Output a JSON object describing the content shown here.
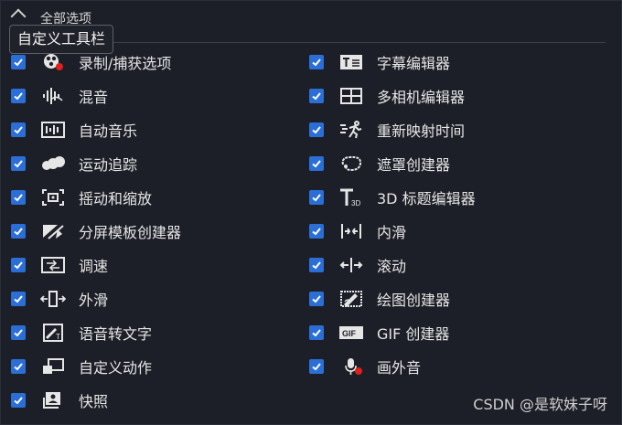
{
  "header": {
    "title": "全部选项",
    "tooltip": "自定义工具栏"
  },
  "left_items": [
    {
      "label": "录制/捕获选项",
      "icon": "record-capture-icon",
      "checked": true
    },
    {
      "label": "混音",
      "icon": "audio-mix-icon",
      "checked": true
    },
    {
      "label": "自动音乐",
      "icon": "auto-music-icon",
      "checked": true
    },
    {
      "label": "运动追踪",
      "icon": "motion-tracking-icon",
      "checked": true
    },
    {
      "label": "摇动和缩放",
      "icon": "pan-zoom-icon",
      "checked": true
    },
    {
      "label": "分屏模板创建器",
      "icon": "split-screen-icon",
      "checked": true
    },
    {
      "label": "调速",
      "icon": "speed-icon",
      "checked": true
    },
    {
      "label": "外滑",
      "icon": "slide-out-icon",
      "checked": true
    },
    {
      "label": "语音转文字",
      "icon": "speech-to-text-icon",
      "checked": true
    },
    {
      "label": "自定义动作",
      "icon": "custom-motion-icon",
      "checked": true
    },
    {
      "label": "快照",
      "icon": "snapshot-icon",
      "checked": true
    }
  ],
  "right_items": [
    {
      "label": "字幕编辑器",
      "icon": "subtitle-editor-icon",
      "checked": true
    },
    {
      "label": "多相机编辑器",
      "icon": "multicam-editor-icon",
      "checked": true
    },
    {
      "label": "重新映射时间",
      "icon": "time-remap-icon",
      "checked": true
    },
    {
      "label": "遮罩创建器",
      "icon": "mask-creator-icon",
      "checked": true
    },
    {
      "label": "3D 标题编辑器",
      "icon": "title-3d-icon",
      "checked": true
    },
    {
      "label": "内滑",
      "icon": "slide-in-icon",
      "checked": true
    },
    {
      "label": "滚动",
      "icon": "scroll-icon",
      "checked": true
    },
    {
      "label": "绘图创建器",
      "icon": "painting-creator-icon",
      "checked": true
    },
    {
      "label": "GIF 创建器",
      "icon": "gif-creator-icon",
      "checked": true
    },
    {
      "label": "画外音",
      "icon": "voiceover-icon",
      "checked": true
    }
  ],
  "watermark": "CSDN @是软妹子呀",
  "colors": {
    "background": "#1c1f27",
    "checkbox": "#2b6fd6",
    "text": "#e6e6e6",
    "record_dot": "#e0201c"
  }
}
